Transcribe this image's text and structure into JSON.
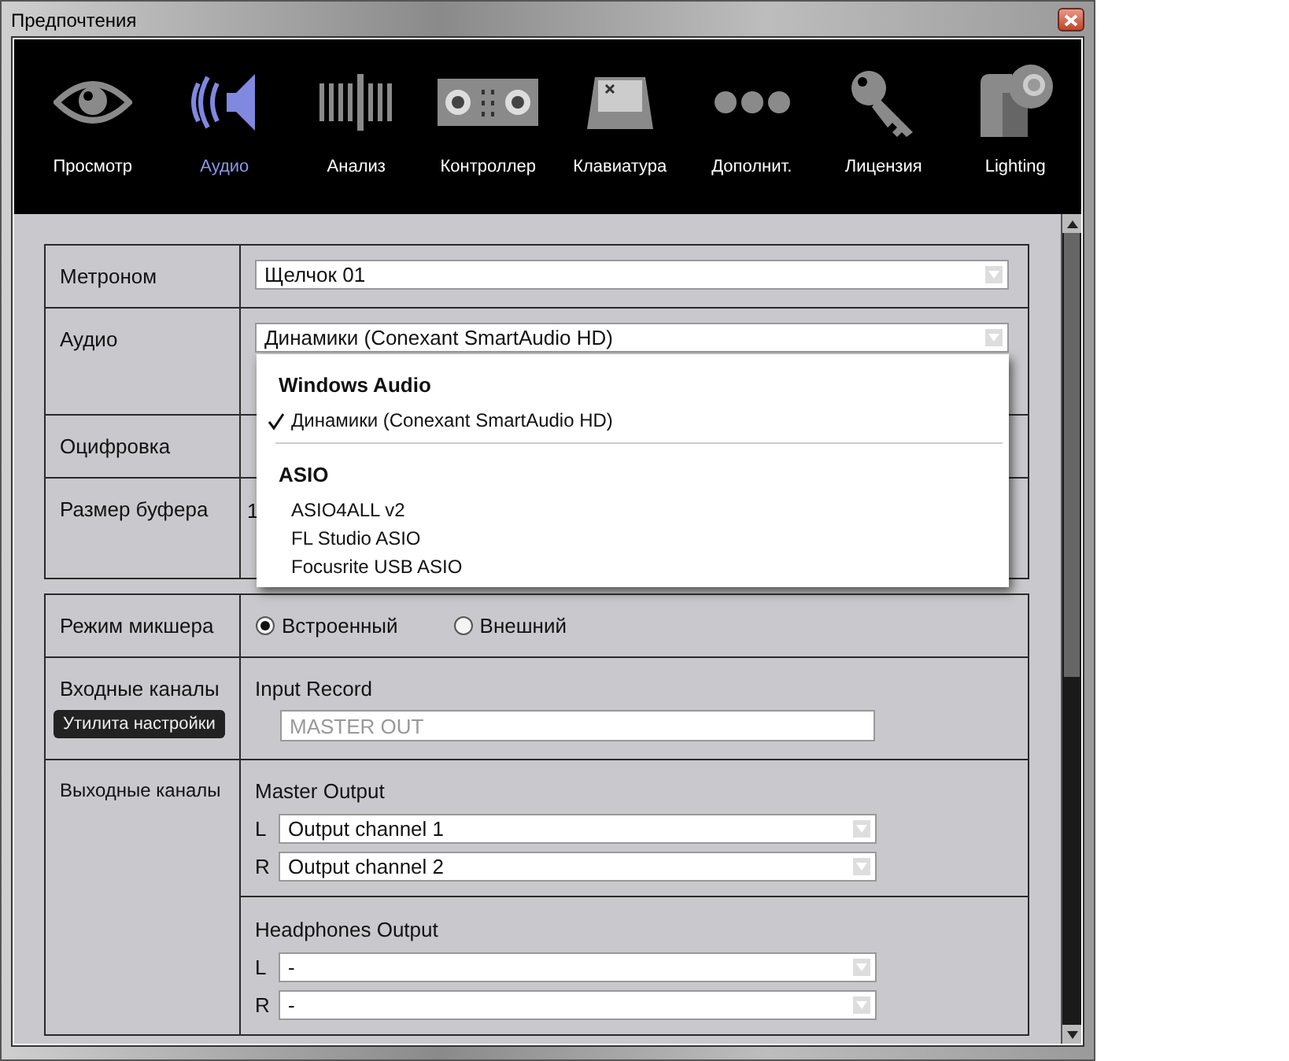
{
  "window": {
    "title": "Предпочтения"
  },
  "tabs": [
    {
      "label": "Просмотр",
      "selected": false
    },
    {
      "label": "Аудио",
      "selected": true
    },
    {
      "label": "Анализ",
      "selected": false
    },
    {
      "label": "Контроллер",
      "selected": false
    },
    {
      "label": "Клавиатура",
      "selected": false
    },
    {
      "label": "Дополнит.",
      "selected": false
    },
    {
      "label": "Лицензия",
      "selected": false
    },
    {
      "label": "Lighting",
      "selected": false
    }
  ],
  "audio_settings": [
    {
      "label": "Метроном",
      "kind": "dropdown",
      "value": "Щелчок 01"
    },
    {
      "label": "Аудио",
      "kind": "dropdown",
      "value": "Динамики (Conexant SmartAudio HD)"
    },
    {
      "label": "Оцифровка",
      "kind": "empty"
    },
    {
      "label": "Размер буфера",
      "kind": "text",
      "value": "1"
    }
  ],
  "audio_menu": [
    {
      "title": "Windows Audio",
      "items": [
        {
          "label": "Динамики (Conexant SmartAudio HD)",
          "checked": true
        }
      ]
    },
    {
      "title": "ASIO",
      "items": [
        {
          "label": "ASIO4ALL v2",
          "checked": false
        },
        {
          "label": "FL Studio ASIO",
          "checked": false
        },
        {
          "label": "Focusrite USB ASIO",
          "checked": false
        }
      ]
    }
  ],
  "mixer": {
    "label": "Режим микшера",
    "options": [
      {
        "label": "Встроенный",
        "selected": true
      },
      {
        "label": "Внешний",
        "selected": false
      }
    ]
  },
  "input_channels": {
    "label": "Входные каналы",
    "button": "Утилита настройки",
    "title": "Input Record",
    "field": {
      "placeholder": "MASTER OUT"
    }
  },
  "output_channels": {
    "label": "Выходные каналы",
    "groups": [
      {
        "title": "Master Output",
        "channels": [
          {
            "side": "L",
            "value": "Output channel 1"
          },
          {
            "side": "R",
            "value": "Output channel 2"
          }
        ]
      },
      {
        "title": "Headphones Output",
        "channels": [
          {
            "side": "L",
            "value": "-"
          },
          {
            "side": "R",
            "value": "-"
          }
        ]
      }
    ]
  }
}
